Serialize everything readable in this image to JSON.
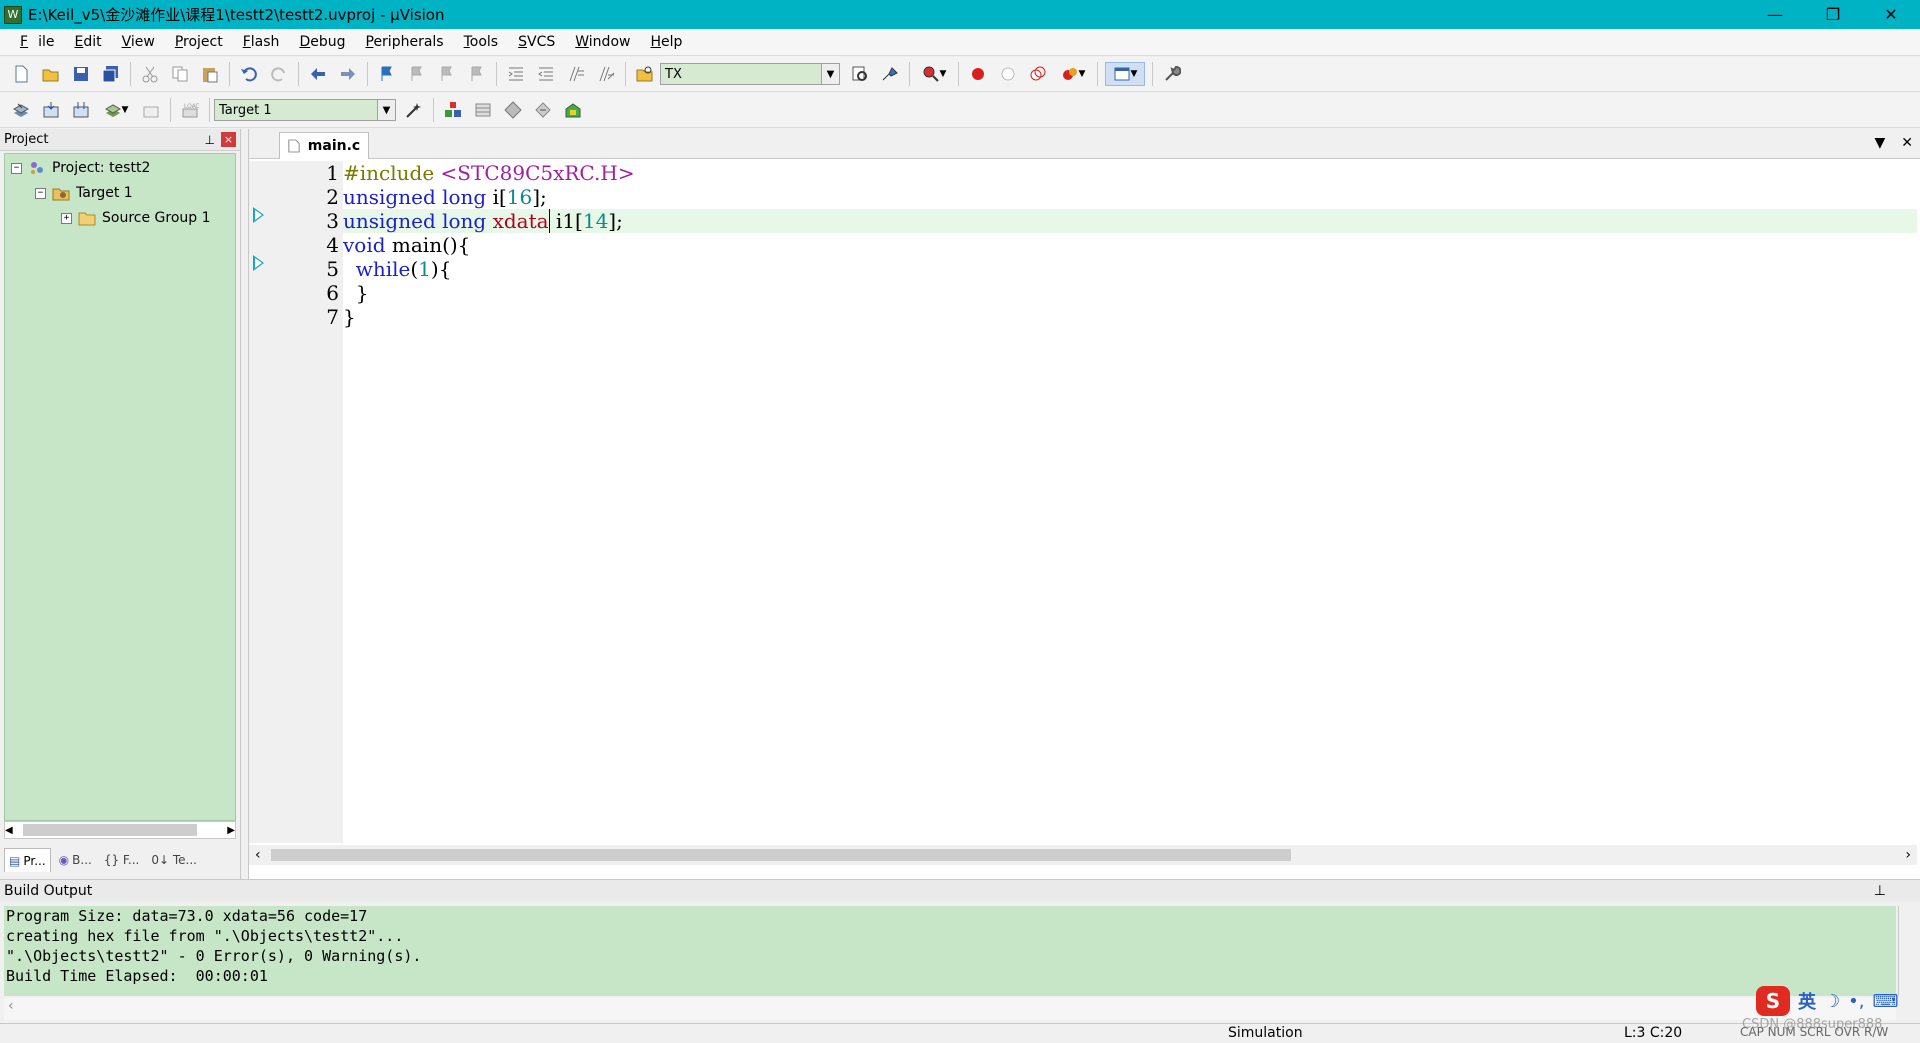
{
  "window": {
    "title": "E:\\Keil_v5\\金沙滩作业\\课程1\\testt2\\testt2.uvproj - µVision",
    "minimize": "—",
    "maximize": "❐",
    "close": "✕"
  },
  "menu": [
    {
      "label": "File",
      "u": "F",
      "rest": "ile"
    },
    {
      "label": "Edit",
      "u": "E",
      "rest": "dit"
    },
    {
      "label": "View",
      "u": "V",
      "rest": "iew"
    },
    {
      "label": "Project",
      "u": "P",
      "rest": "roject"
    },
    {
      "label": "Flash",
      "u": "F",
      "rest": "lash"
    },
    {
      "label": "Debug",
      "u": "D",
      "rest": "ebug"
    },
    {
      "label": "Peripherals",
      "u": "P",
      "rest": "eripherals"
    },
    {
      "label": "Tools",
      "u": "T",
      "rest": "ools"
    },
    {
      "label": "SVCS",
      "u": "S",
      "rest": "VCS"
    },
    {
      "label": "Window",
      "u": "W",
      "rest": "indow"
    },
    {
      "label": "Help",
      "u": "H",
      "rest": "elp"
    }
  ],
  "toolbar": {
    "find_combo_value": "TX",
    "target_combo_value": "Target 1"
  },
  "project_panel": {
    "title": "Project",
    "pin": "ᵖ",
    "close": "×",
    "tree": {
      "project": "Project: testt2",
      "target": "Target 1",
      "group": "Source Group 1"
    },
    "tabs": [
      "Pr...",
      "B...",
      "{} F...",
      "0↓ Te..."
    ]
  },
  "editor": {
    "tab_label": "main.c",
    "line_numbers": [
      "1",
      "2",
      "3",
      "4",
      "5",
      "6",
      "7"
    ]
  },
  "build_output": {
    "title": "Build Output",
    "lines": [
      "Program Size: data=73.0 xdata=56 code=17",
      "creating hex file from \".\\Objects\\testt2\"...",
      "\".\\Objects\\testt2\" - 0 Error(s), 0 Warning(s).",
      "Build Time Elapsed:  00:00:01"
    ]
  },
  "status": {
    "mode": "Simulation",
    "cursor": "L:3 C:20",
    "flags": "CAP  NUM  SCRL  OVR  R/W"
  },
  "ime": {
    "logo": "S",
    "lang": "英",
    "moon": "☽",
    "punct": "•,",
    "kbd": "⌨"
  },
  "watermark": "CSDN @888super888"
}
